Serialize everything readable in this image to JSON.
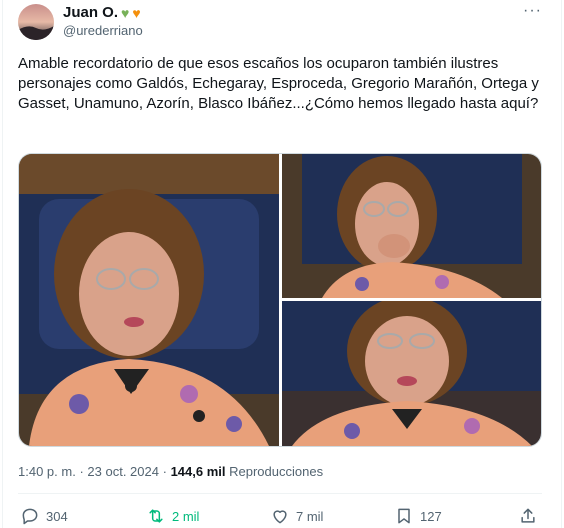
{
  "author": {
    "name": "Juan O.",
    "handle": "@urederriano",
    "badges": [
      "green-heart-icon",
      "orange-heart-icon"
    ]
  },
  "tweet": {
    "text": "Amable recordatorio de que esos escaños los ocuparon también ilustres personajes como Galdós, Echegaray, Esproceda, Gregorio Marañón, Ortega y Gasset, Unamuno, Azorín, Blasco Ibáñez...¿Cómo hemos llegado hasta aquí?"
  },
  "meta": {
    "time": "1:40 p. m.",
    "separator": "·",
    "date": "23 oct. 2024",
    "views": "144,6 mil",
    "views_label": "Reproducciones"
  },
  "actions": {
    "replies": "304",
    "reposts": "2 mil",
    "likes": "7 mil",
    "bookmarks": "127"
  },
  "colors": {
    "repost_active": "#00ba7c",
    "secondary_text": "#536471"
  }
}
